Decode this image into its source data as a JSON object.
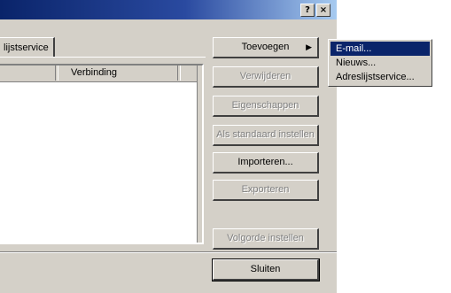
{
  "titlebar": {
    "help_button": "?",
    "close_button": "×"
  },
  "tabs": [
    {
      "label": "lijstservice"
    }
  ],
  "list": {
    "columns": [
      {
        "label": "Verbinding"
      }
    ],
    "rows": []
  },
  "buttons": {
    "toevoegen": "Toevoegen",
    "verwijderen": "Verwijderen",
    "eigenschappen": "Eigenschappen",
    "als_standaard": "Als standaard instellen",
    "importeren": "Importeren...",
    "exporteren": "Exporteren",
    "volgorde": "Volgorde instellen",
    "sluiten": "Sluiten"
  },
  "submenu": {
    "items": [
      {
        "label": "E-mail..."
      },
      {
        "label": "Nieuws..."
      },
      {
        "label": "Adreslijstservice..."
      }
    ]
  }
}
